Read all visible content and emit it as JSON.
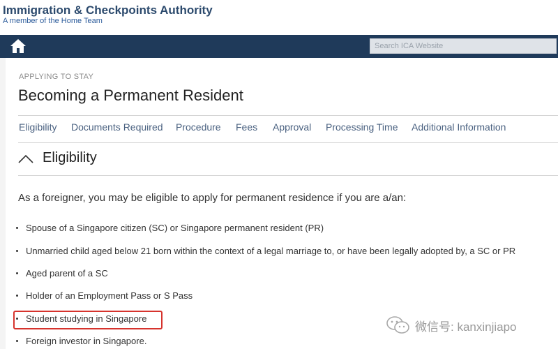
{
  "header": {
    "site_title": "Immigration & Checkpoints Authority",
    "site_subtitle": "A member of the Home Team"
  },
  "navbar": {
    "home_icon": "home-icon",
    "search_placeholder": "Search ICA Website",
    "background_color": "#1f3a5a"
  },
  "page": {
    "breadcrumb": "APPLYING TO STAY",
    "title": "Becoming a Permanent Resident"
  },
  "tabs": [
    {
      "label": "Eligibility"
    },
    {
      "label": "Documents Required"
    },
    {
      "label": "Procedure"
    },
    {
      "label": "Fees"
    },
    {
      "label": "Approval"
    },
    {
      "label": "Processing Time"
    },
    {
      "label": "Additional Information"
    }
  ],
  "section": {
    "toggle_icon": "chevron-up-icon",
    "title": "Eligibility",
    "intro": "As a foreigner, you may be eligible to apply for permanent residence if you are a/an:",
    "items": [
      "Spouse of a Singapore citizen (SC) or Singapore permanent resident (PR)",
      "Unmarried child aged below 21 born within the context of a legal marriage to, or have been legally adopted by, a SC or PR",
      "Aged parent of a SC",
      "Holder of an Employment Pass or S Pass",
      "Student studying in Singapore",
      "Foreign investor in Singapore."
    ],
    "highlighted_item": "Student studying in Singapore",
    "highlight_color": "#d6332d"
  },
  "watermark": {
    "text": "微信号: kanxinjiapo",
    "icon": "wechat-icon"
  }
}
